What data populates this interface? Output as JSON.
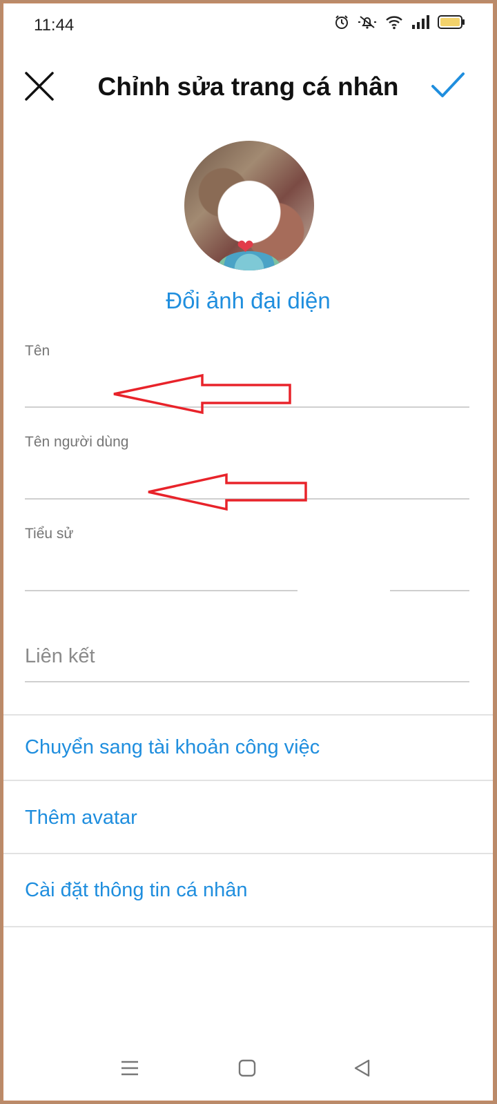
{
  "status_bar": {
    "time": "11:44",
    "icons": [
      "alarm-icon",
      "mute-icon",
      "wifi-icon",
      "signal-icon",
      "battery-icon"
    ]
  },
  "header": {
    "title": "Chỉnh sửa trang cá nhân",
    "close_icon": "close-icon",
    "confirm_icon": "check-icon"
  },
  "profile": {
    "change_photo_label": "Đổi ảnh đại diện"
  },
  "fields": {
    "name_label": "Tên",
    "name_value": "",
    "username_label": "Tên người dùng",
    "username_value": "",
    "bio_label": "Tiểu sử",
    "bio_value": "",
    "link_placeholder": "Liên kết"
  },
  "menu": {
    "items": [
      {
        "label": "Chuyển sang tài khoản công việc"
      },
      {
        "label": "Thêm avatar"
      },
      {
        "label": "Cài đặt thông tin cá nhân"
      }
    ]
  },
  "nav_bar": {
    "icons": [
      "menu-icon",
      "home-icon",
      "back-icon"
    ]
  },
  "colors": {
    "accent": "#1f8ede",
    "annotation_arrow": "#e8232a",
    "frame_border": "#c08a66"
  }
}
